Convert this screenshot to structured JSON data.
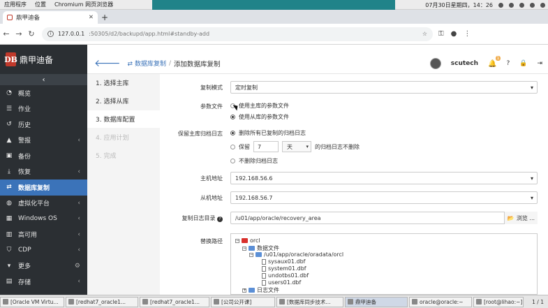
{
  "system": {
    "menu": [
      "应用程序",
      "位置",
      "Chromium 网页浏览器"
    ],
    "datetime": "07月30日星期四，14：26"
  },
  "browser": {
    "tab_title": "鼎甲迪备",
    "new_tab": "+",
    "address_host": "127.0.0.1",
    "address_path": ":50305/d2/backupd/app.html#standby-add"
  },
  "brand": {
    "logo_letters": "DB",
    "name": "鼎甲迪备"
  },
  "sidebar": {
    "collapse_icon": "‹",
    "items": [
      {
        "label": "概览",
        "icon": "dashboard-icon",
        "chev": ""
      },
      {
        "label": "作业",
        "icon": "list-icon",
        "chev": ""
      },
      {
        "label": "历史",
        "icon": "history-icon",
        "chev": ""
      },
      {
        "label": "警报",
        "icon": "warning-icon",
        "chev": "‹"
      },
      {
        "label": "备份",
        "icon": "lock-icon",
        "chev": ""
      },
      {
        "label": "恢复",
        "icon": "download-icon",
        "chev": "‹"
      },
      {
        "label": "数据库复制",
        "icon": "exchange-icon",
        "chev": ""
      },
      {
        "label": "虚拟化平台",
        "icon": "globe-icon",
        "chev": "‹"
      },
      {
        "label": "Windows OS",
        "icon": "windows-icon",
        "chev": "‹"
      },
      {
        "label": "高可用",
        "icon": "columns-icon",
        "chev": "‹"
      },
      {
        "label": "CDP",
        "icon": "shield-icon",
        "chev": "‹"
      },
      {
        "label": "更多",
        "icon": "caret-down-icon",
        "chev": "⚙"
      },
      {
        "label": "存储",
        "icon": "storage-icon",
        "chev": "‹"
      }
    ],
    "active_index": 6
  },
  "topbar": {
    "crumb_link": "数据库复制",
    "crumb_sep": "/",
    "crumb_current": "添加数据库复制",
    "user": "scutech",
    "notification_count": "1"
  },
  "steps": [
    {
      "label": "1. 选择主库",
      "state": "done"
    },
    {
      "label": "2. 选择从库",
      "state": "done"
    },
    {
      "label": "3. 数据库配置",
      "state": "active"
    },
    {
      "label": "4. 应用计划",
      "state": "disabled"
    },
    {
      "label": "5. 完成",
      "state": "disabled"
    }
  ],
  "form": {
    "mode_label": "复制模式",
    "mode_value": "定时复制",
    "param_label": "参数文件",
    "param_opt1": "使用主库的参数文件",
    "param_opt2": "使用从库的参数文件",
    "archive_label": "保留主库归档日志",
    "archive_opt1": "删除所有已复制的归档日志",
    "archive_keep_prefix": "保留",
    "archive_keep_num": "7",
    "archive_keep_unit": "天",
    "archive_keep_suffix": "的归档日志不删除",
    "archive_opt3": "不删除归档日志",
    "host_label": "主机地址",
    "host_value": "192.168.56.6",
    "slave_label": "从机地址",
    "slave_value": "192.168.56.7",
    "logdir_label": "复制日志目录",
    "logdir_value": "/u01/app/oracle/recovery_area",
    "browse_label": "浏览 ...",
    "path_label": "替换路径"
  },
  "tree": {
    "root": "orcl",
    "datafiles": "数据文件",
    "datapath": "/u01/app/oracle/oradata/orcl",
    "files": [
      "sysaux01.dbf",
      "system01.dbf",
      "undotbs01.dbf",
      "users01.dbf"
    ],
    "logfiles": "日志文件"
  },
  "taskbar": {
    "items": [
      "[Oracle VM Virtu...",
      "[redhat7_oracle1...",
      "[redhat7_oracle1...",
      "[公司公开课]",
      "[数据库同步技术...",
      "鼎甲迪备",
      "oracle@oracle:~",
      "[root@lihao:~]"
    ],
    "active_index": 5,
    "pager": "1 / 1"
  },
  "colors": {
    "sidebar_bg": "#2b2f33",
    "active_nav": "#3b73b9",
    "brand_red": "#c0392b",
    "accent_link": "#3b73b9"
  }
}
